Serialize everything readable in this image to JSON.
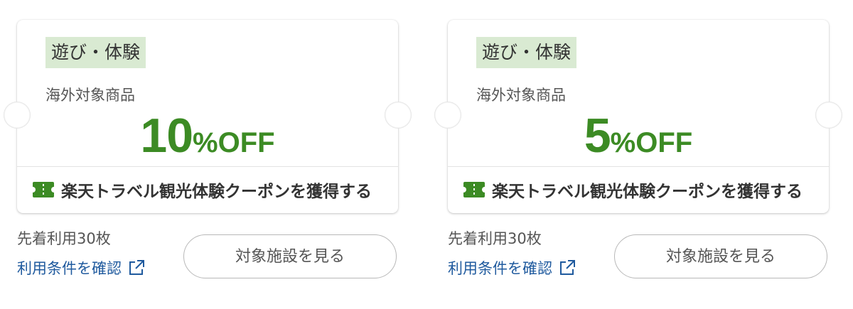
{
  "coupons": [
    {
      "category": "遊び・体験",
      "scope": "海外対象商品",
      "discount_number": "10",
      "discount_suffix": "%OFF",
      "action_label": "楽天トラベル観光体験クーポンを獲得する",
      "limit": "先着利用30枚",
      "terms_link": "利用条件を確認",
      "facility_button": "対象施設を見る"
    },
    {
      "category": "遊び・体験",
      "scope": "海外対象商品",
      "discount_number": "5",
      "discount_suffix": "%OFF",
      "action_label": "楽天トラベル観光体験クーポンを獲得する",
      "limit": "先着利用30枚",
      "terms_link": "利用条件を確認",
      "facility_button": "対象施設を見る"
    }
  ],
  "colors": {
    "accent_green": "#3c8b24",
    "tag_background": "#d9ead2",
    "link_blue": "#1f5a9e"
  },
  "icons": [
    "ticket-icon",
    "external-link-icon"
  ]
}
